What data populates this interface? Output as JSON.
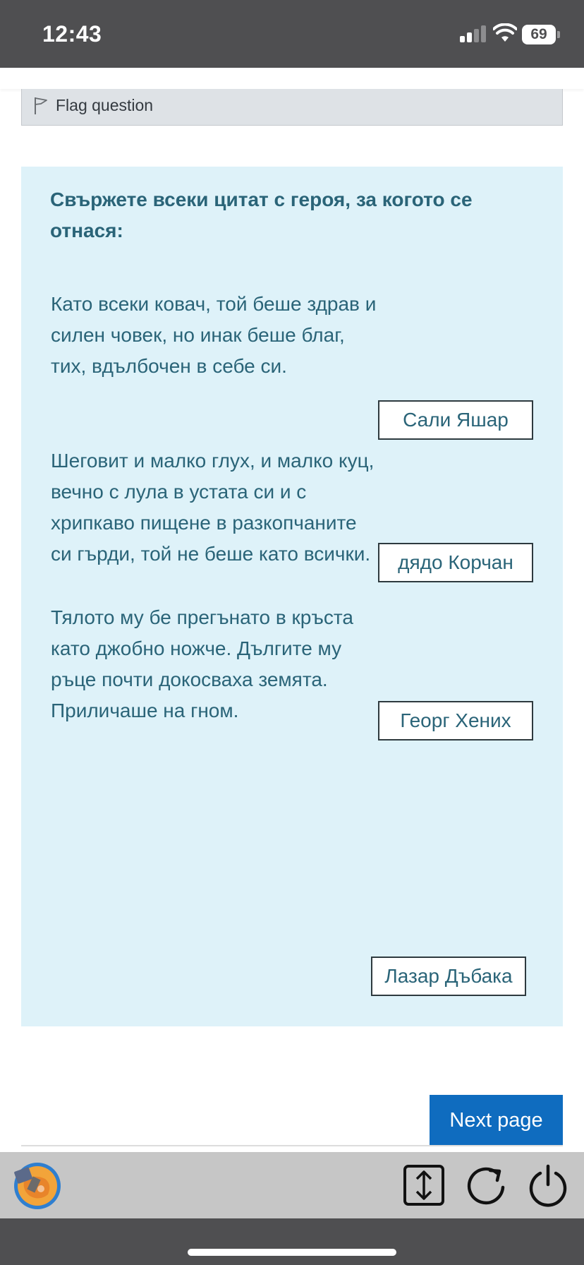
{
  "status_bar": {
    "time": "12:43",
    "battery": "69"
  },
  "flag": {
    "icon": "flag-icon",
    "label": "Flag question"
  },
  "question": {
    "title": "Свържете всеки цитат с героя, за когото се отнася:",
    "quotes": [
      "Като всеки ковач, той беше здрав и силен човек, но инак беше благ, тих, вдълбочен в себе си.",
      "Шеговит и малко глух, и малко куц, вечно с лула в устата си и с хрипкаво пищене в разкопчаните си гърди, той не беше като всички.",
      "Тялото му бе прегънато в кръста като джобно ножче. Дългите му ръце почти докосваха земята. Приличаше на гном."
    ],
    "answers": [
      "Сали Яшар",
      "дядо Корчан",
      "Георг Хених",
      "Лазар Дъбака"
    ]
  },
  "navigation": {
    "next_label": "Next page"
  },
  "toolbar": {
    "icons": [
      "app-logo-icon",
      "scroll-toggle-icon",
      "reload-icon",
      "power-icon"
    ]
  },
  "colors": {
    "status_bar_bg": "#4f4f51",
    "question_bg": "#def2f9",
    "question_text": "#2a6478",
    "primary_button": "#0f6cbf",
    "toolbar_bg": "#c6c6c6"
  }
}
